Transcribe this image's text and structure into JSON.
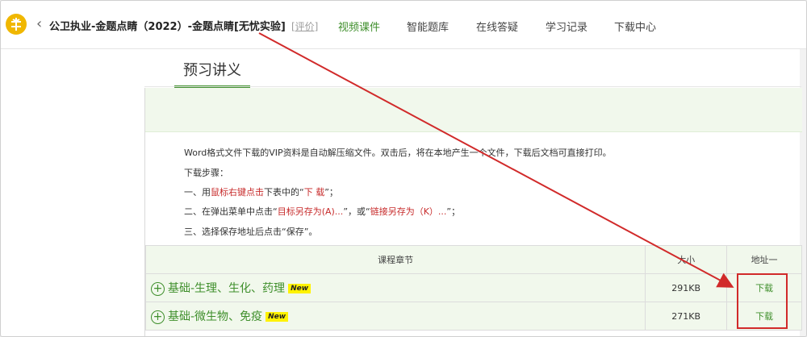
{
  "header": {
    "course_title": "公卫执业-金题点睛（2022）-金题点睛[无忧实验]",
    "rate_label": "[评价]",
    "nav": [
      {
        "label": "视频课件",
        "active": true
      },
      {
        "label": "智能题库",
        "active": false
      },
      {
        "label": "在线答疑",
        "active": false
      },
      {
        "label": "学习记录",
        "active": false
      },
      {
        "label": "下载中心",
        "active": false
      }
    ]
  },
  "section": {
    "tab_label": "预习讲义"
  },
  "instructions": {
    "line1": "Word格式文件下载的VIP资料是自动解压缩文件。双击后，将在本地产生一个文件，下载后文档可直接打印。",
    "line2": "下载步骤：",
    "line3_a": "一、用",
    "line3_red": "鼠标右键点击",
    "line3_b": "下表中的“",
    "line3_red2": "下 载",
    "line3_c": "”；",
    "line4_a": "二、在弹出菜单中点击“",
    "line4_red": "目标另存为(A)...",
    "line4_b": "”，或“",
    "line4_red2": "链接另存为（K）...",
    "line4_c": "”；",
    "line5": "三、选择保存地址后点击“保存”。"
  },
  "table": {
    "headers": {
      "name": "课程章节",
      "size": "大小",
      "addr": "地址一"
    },
    "rows": [
      {
        "name": "基础-生理、生化、药理",
        "badge": "New",
        "size": "291KB",
        "link": "下载"
      },
      {
        "name": "基础-微生物、免疫",
        "badge": "New",
        "size": "271KB",
        "link": "下载"
      }
    ]
  },
  "colors": {
    "accent": "#3f8f2c",
    "annotation": "#d12a2a",
    "badge": "#fff200"
  }
}
